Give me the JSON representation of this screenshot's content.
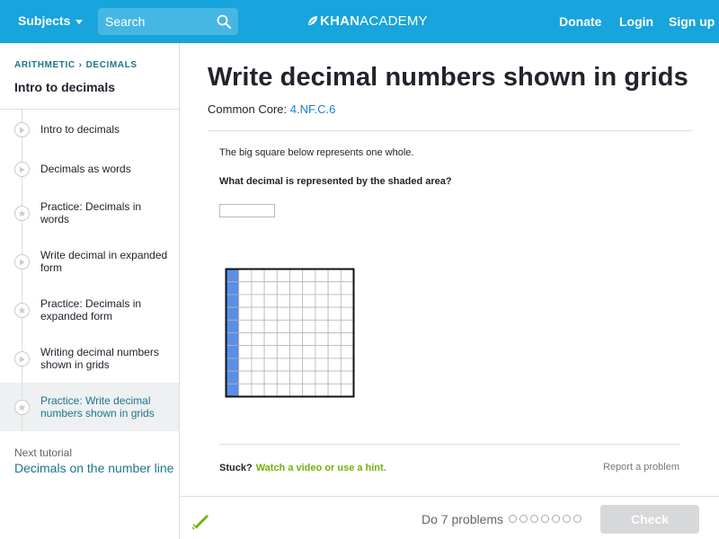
{
  "nav": {
    "subjects_label": "Subjects",
    "search_placeholder": "Search",
    "brand_bold": "KHAN",
    "brand_light": "ACADEMY",
    "donate_label": "Donate",
    "login_label": "Login",
    "signup_label": "Sign up",
    "bg_color": "#18a4dc"
  },
  "sidebar": {
    "breadcrumb_1": "ARITHMETIC",
    "breadcrumb_2": "DECIMALS",
    "title": "Intro to decimals",
    "items": [
      {
        "label": "Intro to decimals",
        "icon": "play-icon"
      },
      {
        "label": "Decimals as words",
        "icon": "play-icon"
      },
      {
        "label": "Practice: Decimals in words",
        "icon": "star-icon"
      },
      {
        "label": "Write decimal in expanded form",
        "icon": "play-icon"
      },
      {
        "label": "Practice: Decimals in expanded form",
        "icon": "star-icon"
      },
      {
        "label": "Writing decimal numbers shown in grids",
        "icon": "play-icon"
      },
      {
        "label": "Practice: Write decimal numbers shown in grids",
        "icon": "star-icon",
        "active": true
      }
    ],
    "next_label": "Next tutorial",
    "next_link": "Decimals on the number line"
  },
  "main": {
    "title": "Write decimal numbers shown in grids",
    "common_core_label": "Common Core:",
    "common_core_code": "4.NF.C.6",
    "question_line1": "The big square below represents one whole.",
    "question_line2": "What decimal is represented by the shaded area?",
    "answer_value": "",
    "grid": {
      "rows": 10,
      "cols": 10,
      "shaded_columns": 1,
      "shade_color": "#5b8fe6"
    },
    "stuck_label": "Stuck?",
    "stuck_link": "Watch a video or use a hint.",
    "report_label": "Report a problem"
  },
  "footer": {
    "do_label": "Do 7 problems",
    "problem_dots": 7,
    "check_label": "Check"
  }
}
